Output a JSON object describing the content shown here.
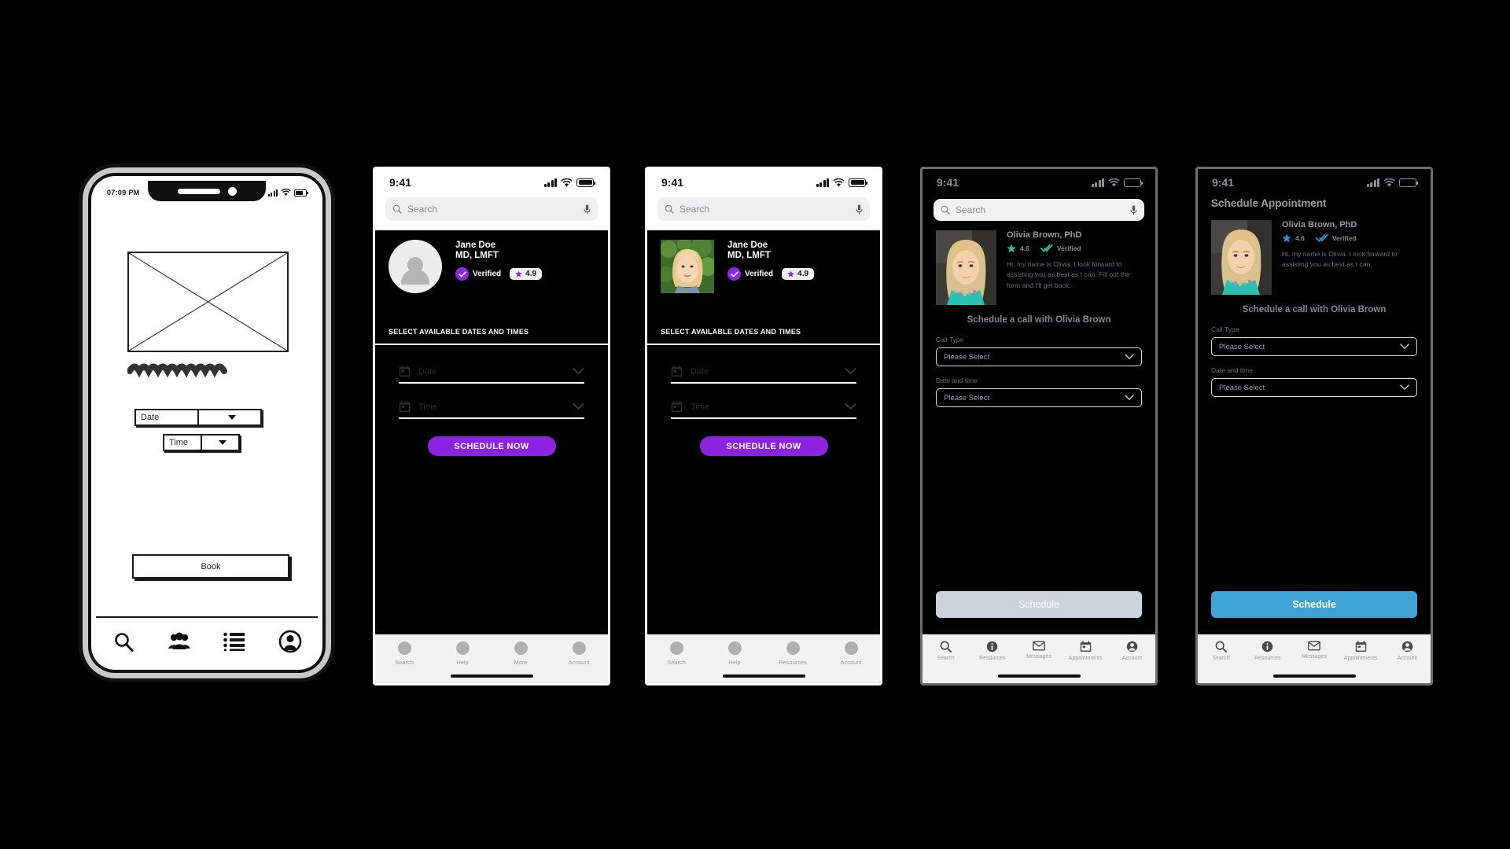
{
  "theme": {
    "purple": "#8b23e0",
    "verified_purple": "#8a2be2",
    "blue_button": "#3ea3d4",
    "disabled_button": "#ccd3dd",
    "teal_star": "#2fbf9e",
    "blue_star": "#2b8fd6",
    "nav_bg": "#f2f2f2",
    "search_bg": "#efeff0"
  },
  "wireframe": {
    "status_time": "07:09 PM",
    "date_select": {
      "value": "Date"
    },
    "time_select": {
      "value": "Time"
    },
    "book_button": "Book",
    "nav": [
      {
        "label": "search",
        "icon": "search-icon"
      },
      {
        "label": "people",
        "icon": "people-icon"
      },
      {
        "label": "list",
        "icon": "list-icon"
      },
      {
        "label": "account",
        "icon": "account-icon"
      }
    ]
  },
  "phone2": {
    "status_time": "9:41",
    "search": {
      "placeholder": "Search",
      "icon": "search-icon",
      "mic": "microphone-icon"
    },
    "profile": {
      "avatar": "placeholder-avatar",
      "name": "Jane Doe",
      "credentials": "MD, LMFT",
      "verified_label": "Verified",
      "rating": "4.9"
    },
    "section_header": "SELECT AVAILABLE DATES AND TIMES",
    "fields": [
      {
        "label": "Date",
        "icon": "calendar-icon"
      },
      {
        "label": "Time",
        "icon": "calendar-icon"
      }
    ],
    "cta": "SCHEDULE NOW",
    "nav": [
      {
        "label": "Search"
      },
      {
        "label": "Help"
      },
      {
        "label": "More"
      },
      {
        "label": "Account"
      }
    ]
  },
  "phone3": {
    "status_time": "9:41",
    "search": {
      "placeholder": "Search",
      "icon": "search-icon",
      "mic": "microphone-icon"
    },
    "profile": {
      "avatar": "photo-portrait",
      "name": "Jane Doe",
      "credentials": "MD, LMFT",
      "verified_label": "Verified",
      "rating": "4.9"
    },
    "section_header": "SELECT AVAILABLE DATES AND TIMES",
    "fields": [
      {
        "label": "Date",
        "icon": "calendar-icon"
      },
      {
        "label": "Time",
        "icon": "calendar-icon"
      }
    ],
    "cta": "SCHEDULE NOW",
    "nav": [
      {
        "label": "Search"
      },
      {
        "label": "Help"
      },
      {
        "label": "Resources"
      },
      {
        "label": "Account"
      }
    ]
  },
  "phone4": {
    "status_time": "9:41",
    "search": {
      "placeholder": "Search",
      "icon": "search-icon",
      "mic": "microphone-icon"
    },
    "profile": {
      "name": "Olivia Brown, PhD",
      "rating": "4.6",
      "verified_label": "Verified",
      "bio": "Hi, my name is Olivia.  I look forward to assisting you as best as I can.  Fill out the form and I'll get back."
    },
    "subtitle": "Schedule a call with Olivia Brown",
    "fields": [
      {
        "label": "Call Type",
        "value": "Please Select"
      },
      {
        "label": "Date and time",
        "value": "Please Select"
      }
    ],
    "cta": {
      "label": "Schedule",
      "state": "disabled"
    },
    "nav": [
      {
        "label": "Search",
        "icon": "search-icon"
      },
      {
        "label": "Resources",
        "icon": "info-icon"
      },
      {
        "label": "Messages",
        "icon": "mail-icon"
      },
      {
        "label": "Appointments",
        "icon": "calendar-icon"
      },
      {
        "label": "Account",
        "icon": "account-icon"
      }
    ]
  },
  "phone5": {
    "status_time": "9:41",
    "title": "Schedule Appointment",
    "profile": {
      "name": "Olivia Brown, PhD",
      "rating": "4.6",
      "verified_label": "Verified",
      "bio": "Hi, my name is Olivia.  I look forward to assisting you as best as I can."
    },
    "subtitle": "Schedule a call with Olivia Brown",
    "fields": [
      {
        "label": "Call Type",
        "value": "Please Select"
      },
      {
        "label": "Date and time",
        "value": "Please Select"
      }
    ],
    "cta": {
      "label": "Schedule",
      "state": "active"
    },
    "nav": [
      {
        "label": "Search",
        "icon": "search-icon"
      },
      {
        "label": "Resources",
        "icon": "info-icon"
      },
      {
        "label": "Messages",
        "icon": "mail-icon"
      },
      {
        "label": "Appointments",
        "icon": "calendar-icon"
      },
      {
        "label": "Account",
        "icon": "account-icon"
      }
    ]
  }
}
